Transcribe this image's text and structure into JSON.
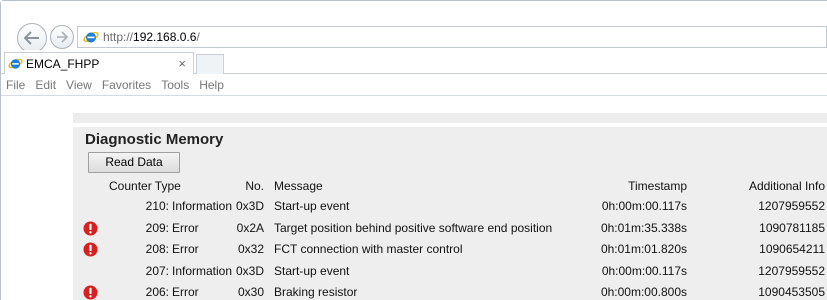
{
  "browser": {
    "url_prefix": "http://",
    "url_host": "192.168.0.6",
    "url_suffix": "/",
    "tab_title": "EMCA_FHPP",
    "tab_close": "×",
    "menu": [
      "File",
      "Edit",
      "View",
      "Favorites",
      "Tools",
      "Help"
    ]
  },
  "panel": {
    "title": "Diagnostic Memory",
    "read_button": "Read Data"
  },
  "table": {
    "headers": {
      "counter_type": "Counter Type",
      "no": "No.",
      "message": "Message",
      "timestamp": "Timestamp",
      "additional": "Additional Info"
    },
    "rows": [
      {
        "error": false,
        "counter": "210:",
        "type": "Information",
        "no": "0x3D",
        "message": "Start-up event",
        "timestamp": "0h:00m:00.117s",
        "additional": "1207959552"
      },
      {
        "error": true,
        "counter": "209:",
        "type": "Error",
        "no": "0x2A",
        "message": "Target position behind positive software end position",
        "timestamp": "0h:01m:35.338s",
        "additional": "1090781185"
      },
      {
        "error": true,
        "counter": "208:",
        "type": "Error",
        "no": "0x32",
        "message": "FCT connection with master control",
        "timestamp": "0h:01m:01.820s",
        "additional": "1090654211"
      },
      {
        "error": false,
        "counter": "207:",
        "type": "Information",
        "no": "0x3D",
        "message": "Start-up event",
        "timestamp": "0h:00m:00.117s",
        "additional": "1207959552"
      },
      {
        "error": true,
        "counter": "206:",
        "type": "Error",
        "no": "0x30",
        "message": "Braking resistor",
        "timestamp": "0h:00m:00.800s",
        "additional": "1090453505"
      }
    ]
  },
  "colors": {
    "error_icon": "#d92020",
    "panel_bg": "#eeeeee"
  }
}
